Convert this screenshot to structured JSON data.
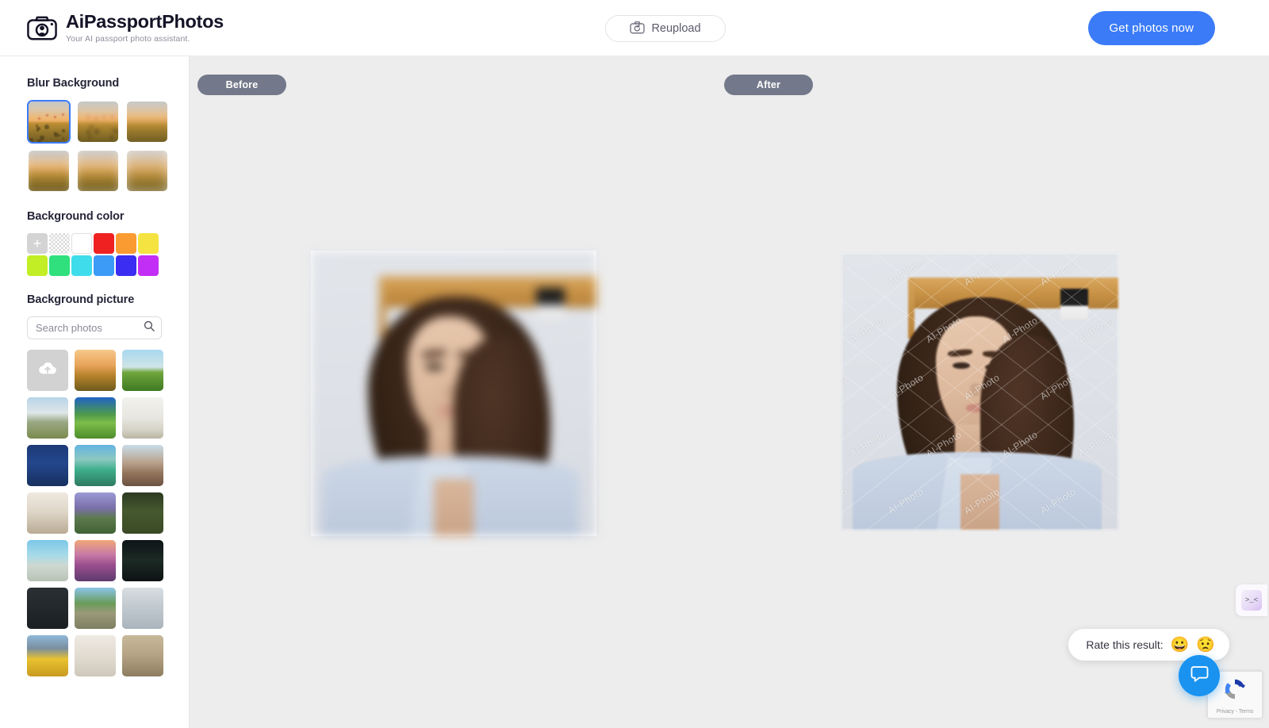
{
  "header": {
    "brand": "AiPassportPhotos",
    "tagline": "Your AI passport photo assistant.",
    "logo_icon": "camera-icon",
    "reupload_label": "Reupload",
    "reupload_icon": "camera-refresh-icon",
    "cta_label": "Get photos now",
    "cta_color": "#3b7bf7"
  },
  "sidebar": {
    "blur_section": {
      "title": "Blur Background",
      "selected_index": 0,
      "options": [
        {
          "name": "blur-level-1",
          "blur": 0.8,
          "selected": true
        },
        {
          "name": "blur-level-2",
          "blur": 2.4,
          "selected": false
        },
        {
          "name": "blur-level-3",
          "blur": 4.0,
          "selected": false
        },
        {
          "name": "blur-level-4",
          "blur": 6.0,
          "selected": false
        },
        {
          "name": "blur-level-5",
          "blur": 7.5,
          "selected": false
        },
        {
          "name": "blur-level-6",
          "blur": 9.0,
          "selected": false
        }
      ]
    },
    "color_section": {
      "title": "Background color",
      "add_label": "+",
      "swatches": [
        {
          "name": "add-custom-color",
          "type": "add",
          "color": "#d4d4d4"
        },
        {
          "name": "transparent",
          "type": "transparent",
          "color": "transparent"
        },
        {
          "name": "white",
          "type": "solid",
          "color": "#ffffff"
        },
        {
          "name": "red",
          "type": "solid",
          "color": "#ef2121"
        },
        {
          "name": "orange",
          "type": "solid",
          "color": "#fa9b32"
        },
        {
          "name": "yellow",
          "type": "solid",
          "color": "#f5e342"
        },
        {
          "name": "lime",
          "type": "solid",
          "color": "#c2ee25"
        },
        {
          "name": "green",
          "type": "solid",
          "color": "#2fe07d"
        },
        {
          "name": "cyan",
          "type": "solid",
          "color": "#3fdcec"
        },
        {
          "name": "blue",
          "type": "solid",
          "color": "#3c9bf7"
        },
        {
          "name": "indigo",
          "type": "solid",
          "color": "#3b2ef2"
        },
        {
          "name": "magenta",
          "type": "solid",
          "color": "#c22ef5"
        }
      ]
    },
    "picture_section": {
      "title": "Background picture",
      "search_placeholder": "Search photos",
      "search_value": "",
      "search_icon": "search-icon",
      "photos": [
        {
          "name": "upload-photo-tile",
          "label": "upload",
          "kind": "upload"
        },
        {
          "name": "photo-sunset-field",
          "kind": "image"
        },
        {
          "name": "photo-lone-tree-green-field",
          "kind": "image"
        },
        {
          "name": "photo-matterhorn-mountain",
          "kind": "image"
        },
        {
          "name": "photo-green-mountain-valley",
          "kind": "image"
        },
        {
          "name": "photo-interior-shelf-plants",
          "kind": "image"
        },
        {
          "name": "photo-moon-night-sky",
          "kind": "image"
        },
        {
          "name": "photo-green-car-tree",
          "kind": "image"
        },
        {
          "name": "photo-desert-landscape",
          "kind": "image"
        },
        {
          "name": "photo-curtain-window",
          "kind": "image"
        },
        {
          "name": "photo-purple-mountains-dusk",
          "kind": "image"
        },
        {
          "name": "photo-tree-white-chair",
          "kind": "image"
        },
        {
          "name": "photo-beach-pier",
          "kind": "image"
        },
        {
          "name": "photo-flower-field-sunset",
          "kind": "image"
        },
        {
          "name": "photo-ferris-wheel-night",
          "kind": "image"
        },
        {
          "name": "photo-chalkboard-equations",
          "kind": "image"
        },
        {
          "name": "photo-garden-path",
          "kind": "image"
        },
        {
          "name": "photo-birch-forest-snow",
          "kind": "image"
        },
        {
          "name": "photo-tulip-field",
          "kind": "image"
        },
        {
          "name": "photo-white-hall-interior",
          "kind": "image"
        },
        {
          "name": "photo-stone-columns",
          "kind": "image"
        }
      ]
    }
  },
  "canvas": {
    "before_label": "Before",
    "after_label": "After",
    "pill_color": "#73798a",
    "background": "#ededed",
    "watermark_text": "AI-Photo"
  },
  "widgets": {
    "side_tab_glyph": ">_<",
    "rate_label": "Rate this result:",
    "rate_positive_emoji": "😀",
    "rate_negative_emoji": "😟",
    "chat_icon": "chat-bubble-icon",
    "recaptcha_terms": "Privacy - Terms",
    "recaptcha_icon": "recaptcha-icon"
  }
}
